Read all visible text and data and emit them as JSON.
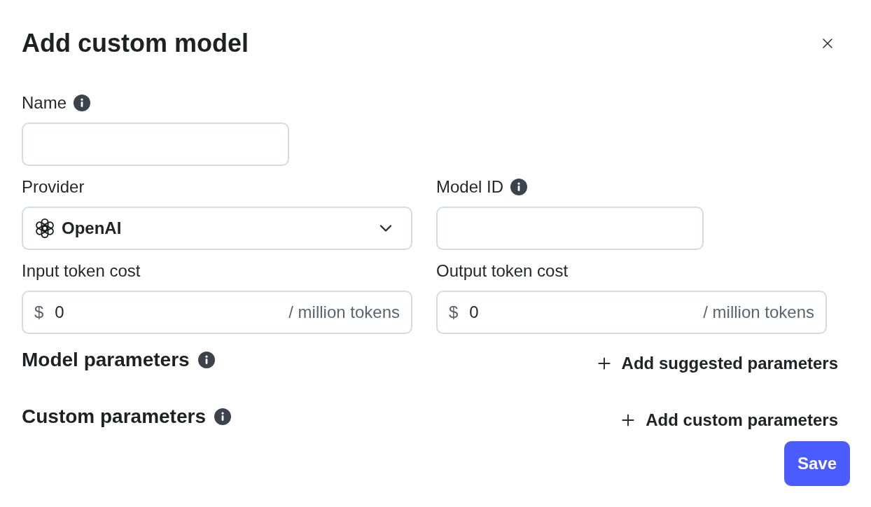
{
  "title": "Add custom model",
  "rows": [
    {
      "fields": [
        {
          "kind": "text",
          "label": "Name",
          "info": true
        }
      ]
    },
    {
      "fields": [
        {
          "kind": "select",
          "label": "Provider",
          "info": false,
          "value": "OpenAI"
        },
        {
          "kind": "text",
          "label": "Model ID",
          "info": true
        }
      ]
    },
    {
      "fields": [
        {
          "kind": "cost",
          "label": "Input token cost",
          "info": false,
          "prefix": "$",
          "value": "0",
          "suffix": "/ million tokens"
        },
        {
          "kind": "cost",
          "label": "Output token cost",
          "info": false,
          "prefix": "$",
          "value": "0",
          "suffix": "/ million tokens"
        }
      ]
    }
  ],
  "sections": [
    {
      "title": "Model parameters",
      "info": true,
      "action": "Add suggested parameters"
    },
    {
      "title": "Custom parameters",
      "info": true,
      "action": "Add custom parameters"
    }
  ],
  "primary_button": {
    "label": "Save"
  }
}
